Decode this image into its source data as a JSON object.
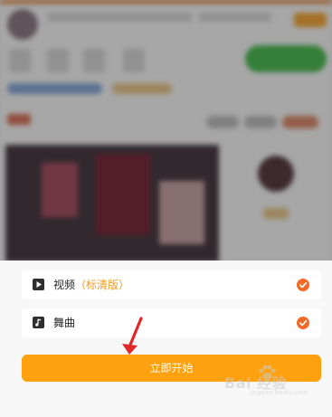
{
  "options": [
    {
      "label": "视频",
      "sublabel": "（标清版）",
      "icon": "play-icon",
      "selected": true
    },
    {
      "label": "舞曲",
      "icon": "music-note-icon",
      "selected": true
    }
  ],
  "start_button": {
    "label": "立即开始"
  },
  "watermark": {
    "text": "Bai 经验",
    "url": "jingyan.baidu.com"
  },
  "colors": {
    "accent": "#ffa10f",
    "check": "#f06a2a",
    "sublabel": "#f29b1c",
    "arrow": "#e0282b"
  }
}
